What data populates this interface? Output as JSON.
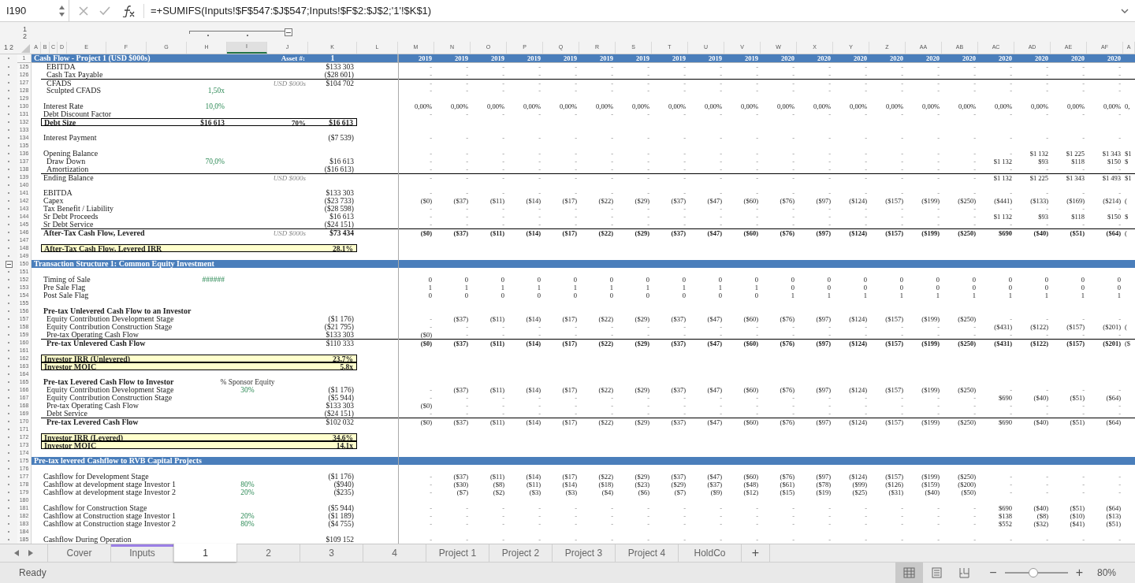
{
  "formula_bar": {
    "cell": "I190",
    "formula": "=+SUMIFS(Inputs!$F$547:$J$547;Inputs!$F$2:$J$2;'1'!$K$1)"
  },
  "outline": {
    "row_levels": [
      "1",
      "2"
    ],
    "col_levels": [
      "1",
      "2"
    ],
    "column_group_expanded": true
  },
  "columns": [
    {
      "letter": "A",
      "selected": false
    },
    {
      "letter": "B",
      "selected": false
    },
    {
      "letter": "C",
      "selected": false
    },
    {
      "letter": "D",
      "selected": false
    },
    {
      "letter": "E",
      "selected": false
    },
    {
      "letter": "F",
      "selected": false
    },
    {
      "letter": "G",
      "selected": false
    },
    {
      "letter": "H",
      "selected": false
    },
    {
      "letter": "I",
      "selected": true
    },
    {
      "letter": "J",
      "selected": false
    },
    {
      "letter": "K",
      "selected": false
    },
    {
      "letter": "L",
      "selected": false
    },
    {
      "letter": "M",
      "selected": false
    },
    {
      "letter": "N",
      "selected": false
    },
    {
      "letter": "O",
      "selected": false
    },
    {
      "letter": "P",
      "selected": false
    },
    {
      "letter": "Q",
      "selected": false
    },
    {
      "letter": "R",
      "selected": false
    },
    {
      "letter": "S",
      "selected": false
    },
    {
      "letter": "T",
      "selected": false
    },
    {
      "letter": "U",
      "selected": false
    },
    {
      "letter": "V",
      "selected": false
    },
    {
      "letter": "W",
      "selected": false
    },
    {
      "letter": "X",
      "selected": false
    },
    {
      "letter": "Y",
      "selected": false
    },
    {
      "letter": "Z",
      "selected": false
    },
    {
      "letter": "AA",
      "selected": false
    },
    {
      "letter": "AB",
      "selected": false
    },
    {
      "letter": "AC",
      "selected": false
    },
    {
      "letter": "AD",
      "selected": false
    },
    {
      "letter": "AE",
      "selected": false
    },
    {
      "letter": "AF",
      "selected": false
    },
    {
      "letter": "A",
      "selected": false
    }
  ],
  "header_row": {
    "num": "1",
    "title": "Cash Flow - Project 1 (USD $000s)",
    "j": "Asset #:",
    "k": "1",
    "years": [
      "2019",
      "2019",
      "2019",
      "2019",
      "2019",
      "2019",
      "2019",
      "2019",
      "2019",
      "2019",
      "2020",
      "2020",
      "2020",
      "2020",
      "2020",
      "2020",
      "2020",
      "2020",
      "2020",
      "2020"
    ]
  },
  "rows": [
    {
      "num": "125",
      "kind": "subitem",
      "label": "EBITDA",
      "k": "$133 303",
      "k_bold": false,
      "t": [
        "-",
        "-",
        "-",
        "-",
        "-",
        "-",
        "-",
        "-",
        "-",
        "-",
        "-",
        "-",
        "-",
        "-",
        "-",
        "-",
        "-",
        "-",
        "-",
        "-"
      ]
    },
    {
      "num": "126",
      "kind": "subitem",
      "label": "Cash Tax Payable",
      "k": "($28 601)",
      "k_bold": false,
      "t": [
        "-",
        "-",
        "-",
        "-",
        "-",
        "-",
        "-",
        "-",
        "-",
        "-",
        "-",
        "-",
        "-",
        "-",
        "-",
        "-",
        "-",
        "-",
        "-",
        "-"
      ]
    },
    {
      "num": "127",
      "kind": "subtotal",
      "label": "CFADS",
      "j": "USD $000s",
      "k": "$104 702",
      "k_bold": false,
      "t": [
        "-",
        "-",
        "-",
        "-",
        "-",
        "-",
        "-",
        "-",
        "-",
        "-",
        "-",
        "-",
        "-",
        "-",
        "-",
        "-",
        "-",
        "-",
        "-",
        "-"
      ]
    },
    {
      "num": "128",
      "kind": "subitem",
      "label": "Sculpted CFADS",
      "h": "1,50x",
      "h_input": true,
      "t": [
        "-",
        "-",
        "-",
        "-",
        "-",
        "-",
        "-",
        "-",
        "-",
        "-",
        "-",
        "-",
        "-",
        "-",
        "-",
        "-",
        "-",
        "-",
        "-",
        "-"
      ]
    },
    {
      "num": "129",
      "kind": "blank"
    },
    {
      "num": "130",
      "kind": "item",
      "label": "Interest Rate",
      "h": "10,0%",
      "h_input": true,
      "t": [
        "0,00%",
        "0,00%",
        "0,00%",
        "0,00%",
        "0,00%",
        "0,00%",
        "0,00%",
        "0,00%",
        "0,00%",
        "0,00%",
        "0,00%",
        "0,00%",
        "0,00%",
        "0,00%",
        "0,00%",
        "0,00%",
        "0,00%",
        "0,00%",
        "0,00%",
        "0,00%"
      ],
      "t_bold": false,
      "tail": "0,"
    },
    {
      "num": "131",
      "kind": "item",
      "label": "Debt Discount Factor",
      "t": [
        "-",
        "-",
        "-",
        "-",
        "-",
        "-",
        "-",
        "-",
        "-",
        "-",
        "-",
        "-",
        "-",
        "-",
        "-",
        "-",
        "-",
        "-",
        "-",
        "-"
      ]
    },
    {
      "num": "132",
      "kind": "box",
      "label": "Debt Size",
      "h": "$16 613",
      "h_input": false,
      "j": "70%",
      "k": "$16 613",
      "k_bold": true
    },
    {
      "num": "133",
      "kind": "blank"
    },
    {
      "num": "134",
      "kind": "item",
      "label": "Interest Payment",
      "k": "($7 539)",
      "k_bold": false,
      "t": [
        "-",
        "-",
        "-",
        "-",
        "-",
        "-",
        "-",
        "-",
        "-",
        "-",
        "-",
        "-",
        "-",
        "-",
        "-",
        "-",
        "-",
        "-",
        "-",
        "-"
      ]
    },
    {
      "num": "135",
      "kind": "blank"
    },
    {
      "num": "136",
      "kind": "item",
      "label": "Opening Balance",
      "t": [
        "-",
        "-",
        "-",
        "-",
        "-",
        "-",
        "-",
        "-",
        "-",
        "-",
        "-",
        "-",
        "-",
        "-",
        "-",
        "-",
        "-",
        "$1 132",
        "$1 225",
        "$1 343"
      ],
      "t_bold": false,
      "tail": "$1"
    },
    {
      "num": "137",
      "kind": "subitem",
      "label": "Draw Down",
      "h": "70,0%",
      "h_input": true,
      "k": "$16 613",
      "k_bold": false,
      "t": [
        "-",
        "-",
        "-",
        "-",
        "-",
        "-",
        "-",
        "-",
        "-",
        "-",
        "-",
        "-",
        "-",
        "-",
        "-",
        "-",
        "$1 132",
        "$93",
        "$118",
        "$150"
      ],
      "t_bold": false,
      "tail": "$"
    },
    {
      "num": "138",
      "kind": "subitem",
      "label": "Amortization",
      "k": "($16 613)",
      "k_bold": false,
      "t": [
        "-",
        "-",
        "-",
        "-",
        "-",
        "-",
        "-",
        "-",
        "-",
        "-",
        "-",
        "-",
        "-",
        "-",
        "-",
        "-",
        "-",
        "-",
        "-",
        "-"
      ]
    },
    {
      "num": "139",
      "kind": "total",
      "label": "Ending Balance",
      "j": "USD $000s",
      "t": [
        "-",
        "-",
        "-",
        "-",
        "-",
        "-",
        "-",
        "-",
        "-",
        "-",
        "-",
        "-",
        "-",
        "-",
        "-",
        "-",
        "$1 132",
        "$1 225",
        "$1 343",
        "$1 493"
      ],
      "t_bold": false,
      "tail": "$1"
    },
    {
      "num": "140",
      "kind": "blank"
    },
    {
      "num": "141",
      "kind": "item",
      "label": "EBITDA",
      "k": "$133 303",
      "k_bold": false,
      "t": [
        "-",
        "-",
        "-",
        "-",
        "-",
        "-",
        "-",
        "-",
        "-",
        "-",
        "-",
        "-",
        "-",
        "-",
        "-",
        "-",
        "-",
        "-",
        "-",
        "-"
      ]
    },
    {
      "num": "142",
      "kind": "item",
      "label": "Capex",
      "k": "($23 733)",
      "k_bold": false,
      "t": [
        "($0)",
        "($37)",
        "($11)",
        "($14)",
        "($17)",
        "($22)",
        "($29)",
        "($37)",
        "($47)",
        "($60)",
        "($76)",
        "($97)",
        "($124)",
        "($157)",
        "($199)",
        "($250)",
        "($441)",
        "($133)",
        "($169)",
        "($214)"
      ],
      "t_bold": false,
      "tail": "("
    },
    {
      "num": "143",
      "kind": "item",
      "label": "Tax Benefit / Liability",
      "k": "($28 598)",
      "k_bold": false,
      "t": [
        "-",
        "-",
        "-",
        "-",
        "-",
        "-",
        "-",
        "-",
        "-",
        "-",
        "-",
        "-",
        "-",
        "-",
        "-",
        "-",
        "-",
        "-",
        "-",
        "-"
      ]
    },
    {
      "num": "144",
      "kind": "item",
      "label": "Sr Debt Proceeds",
      "k": "$16 613",
      "k_bold": false,
      "t": [
        "-",
        "-",
        "-",
        "-",
        "-",
        "-",
        "-",
        "-",
        "-",
        "-",
        "-",
        "-",
        "-",
        "-",
        "-",
        "-",
        "$1 132",
        "$93",
        "$118",
        "$150"
      ],
      "t_bold": false,
      "tail": "$"
    },
    {
      "num": "145",
      "kind": "item",
      "label": "Sr Debt Service",
      "k": "($24 151)",
      "k_bold": false,
      "t": [
        "-",
        "-",
        "-",
        "-",
        "-",
        "-",
        "-",
        "-",
        "-",
        "-",
        "-",
        "-",
        "-",
        "-",
        "-",
        "-",
        "-",
        "-",
        "-",
        "-"
      ]
    },
    {
      "num": "146",
      "kind": "grand_total",
      "label": "After-Tax Cash Flow, Levered",
      "j": "USD $000s",
      "k": "$73 434",
      "k_bold": true,
      "t": [
        "($0)",
        "($37)",
        "($11)",
        "($14)",
        "($17)",
        "($22)",
        "($29)",
        "($37)",
        "($47)",
        "($60)",
        "($76)",
        "($97)",
        "($124)",
        "($157)",
        "($199)",
        "($250)",
        "$690",
        "($40)",
        "($51)",
        "($64)"
      ],
      "t_bold": true,
      "tail": "("
    },
    {
      "num": "147",
      "kind": "blank"
    },
    {
      "num": "148",
      "kind": "highlight",
      "label": "After-Tax Cash Flow, Levered IRR",
      "k": "28,1%",
      "k_bold": true
    },
    {
      "num": "149",
      "kind": "blank"
    },
    {
      "num": "150",
      "kind": "section",
      "label": "Transaction Structure 1: Common Equity Investment",
      "expanded": true
    },
    {
      "num": "151",
      "kind": "blank"
    },
    {
      "num": "152",
      "kind": "item",
      "label": "Timing of Sale",
      "h": "######",
      "h_input": true,
      "t": [
        "0",
        "0",
        "0",
        "0",
        "0",
        "0",
        "0",
        "0",
        "0",
        "0",
        "0",
        "0",
        "0",
        "0",
        "0",
        "0",
        "0",
        "0",
        "0",
        "0"
      ],
      "t_bold": false
    },
    {
      "num": "153",
      "kind": "item",
      "label": "Pre Sale Flag",
      "t": [
        "1",
        "1",
        "1",
        "1",
        "1",
        "1",
        "1",
        "1",
        "1",
        "1",
        "0",
        "0",
        "0",
        "0",
        "0",
        "0",
        "0",
        "0",
        "0",
        "0"
      ],
      "t_bold": false
    },
    {
      "num": "154",
      "kind": "item",
      "label": "Post Sale Flag",
      "t": [
        "0",
        "0",
        "0",
        "0",
        "0",
        "0",
        "0",
        "0",
        "0",
        "0",
        "1",
        "1",
        "1",
        "1",
        "1",
        "1",
        "1",
        "1",
        "1",
        "1"
      ],
      "t_bold": false
    },
    {
      "num": "155",
      "kind": "blank"
    },
    {
      "num": "156",
      "kind": "heading",
      "label": "Pre-tax Unlevered Cash Flow to an Investor"
    },
    {
      "num": "157",
      "kind": "subitem",
      "label": "Equity Contribution Development Stage",
      "k": "($1 176)",
      "k_bold": false,
      "t": [
        "-",
        "($37)",
        "($11)",
        "($14)",
        "($17)",
        "($22)",
        "($29)",
        "($37)",
        "($47)",
        "($60)",
        "($76)",
        "($97)",
        "($124)",
        "($157)",
        "($199)",
        "($250)",
        "-",
        "-",
        "-",
        "-"
      ],
      "t_bold": false
    },
    {
      "num": "158",
      "kind": "subitem",
      "label": "Equity Contribution Construction Stage",
      "k": "($21 795)",
      "k_bold": false,
      "t": [
        "-",
        "-",
        "-",
        "-",
        "-",
        "-",
        "-",
        "-",
        "-",
        "-",
        "-",
        "-",
        "-",
        "-",
        "-",
        "-",
        "($431)",
        "($122)",
        "($157)",
        "($201)"
      ],
      "t_bold": false,
      "tail": "("
    },
    {
      "num": "159",
      "kind": "subitem",
      "label": "Pre-tax Operating Cash Flow",
      "k": "$133 303",
      "k_bold": false,
      "t": [
        "($0)",
        "-",
        "-",
        "-",
        "-",
        "-",
        "-",
        "-",
        "-",
        "-",
        "-",
        "-",
        "-",
        "-",
        "-",
        "-",
        "-",
        "-",
        "-",
        "-"
      ],
      "t_bold": false
    },
    {
      "num": "160",
      "kind": "net_total",
      "label": "Pre-tax Unlevered Cash Flow",
      "k": "$110 333",
      "k_bold": false,
      "t": [
        "($0)",
        "($37)",
        "($11)",
        "($14)",
        "($17)",
        "($22)",
        "($29)",
        "($37)",
        "($47)",
        "($60)",
        "($76)",
        "($97)",
        "($124)",
        "($157)",
        "($199)",
        "($250)",
        "($431)",
        "($122)",
        "($157)",
        "($201)"
      ],
      "t_bold": true,
      "tail": "($"
    },
    {
      "num": "161",
      "kind": "blank"
    },
    {
      "num": "162",
      "kind": "highlight",
      "label": "Investor IRR (Unlevered)",
      "k": "23,7%",
      "k_bold": true
    },
    {
      "num": "163",
      "kind": "highlight",
      "label": "Investor MOIC",
      "k": "5,8x",
      "k_bold": true
    },
    {
      "num": "164",
      "kind": "blank"
    },
    {
      "num": "165",
      "kind": "heading",
      "label": "Pre-tax Levered Cash Flow to Investor",
      "i": "% Sponsor Equity",
      "i_input": false
    },
    {
      "num": "166",
      "kind": "subitem",
      "label": "Equity Contribution Development Stage",
      "i": "30%",
      "i_input": true,
      "k": "($1 176)",
      "k_bold": false,
      "t": [
        "-",
        "($37)",
        "($11)",
        "($14)",
        "($17)",
        "($22)",
        "($29)",
        "($37)",
        "($47)",
        "($60)",
        "($76)",
        "($97)",
        "($124)",
        "($157)",
        "($199)",
        "($250)",
        "-",
        "-",
        "-",
        "-"
      ],
      "t_bold": false
    },
    {
      "num": "167",
      "kind": "subitem",
      "label": "Equity Contribution Construction Stage",
      "k": "($5 944)",
      "k_bold": false,
      "t": [
        "-",
        "-",
        "-",
        "-",
        "-",
        "-",
        "-",
        "-",
        "-",
        "-",
        "-",
        "-",
        "-",
        "-",
        "-",
        "-",
        "$690",
        "($40)",
        "($51)",
        "($64)"
      ],
      "t_bold": false
    },
    {
      "num": "168",
      "kind": "subitem",
      "label": "Pre-tax Operating Cash Flow",
      "k": "$133 303",
      "k_bold": false,
      "t": [
        "($0)",
        "-",
        "-",
        "-",
        "-",
        "-",
        "-",
        "-",
        "-",
        "-",
        "-",
        "-",
        "-",
        "-",
        "-",
        "-",
        "-",
        "-",
        "-",
        "-"
      ],
      "t_bold": false
    },
    {
      "num": "169",
      "kind": "subitem",
      "label": "Debt Service",
      "k": "($24 151)",
      "k_bold": false,
      "t": [
        "-",
        "-",
        "-",
        "-",
        "-",
        "-",
        "-",
        "-",
        "-",
        "-",
        "-",
        "-",
        "-",
        "-",
        "-",
        "-",
        "-",
        "-",
        "-",
        "-"
      ]
    },
    {
      "num": "170",
      "kind": "net_total",
      "label": "Pre-tax Levered Cash Flow",
      "k": "$102 032",
      "k_bold": false,
      "t": [
        "($0)",
        "($37)",
        "($11)",
        "($14)",
        "($17)",
        "($22)",
        "($29)",
        "($37)",
        "($47)",
        "($60)",
        "($76)",
        "($97)",
        "($124)",
        "($157)",
        "($199)",
        "($250)",
        "$690",
        "($40)",
        "($51)",
        "($64)"
      ],
      "t_bold": false
    },
    {
      "num": "171",
      "kind": "blank"
    },
    {
      "num": "172",
      "kind": "highlight",
      "label": "Investor IRR (Levered)",
      "k": "34,6%",
      "k_bold": true
    },
    {
      "num": "173",
      "kind": "highlight",
      "label": "Investor MOIC",
      "k": "14,1x",
      "k_bold": true
    },
    {
      "num": "174",
      "kind": "blank"
    },
    {
      "num": "175",
      "kind": "section",
      "label": "Pre-tax levered Cashflow to RVB Capital Projects"
    },
    {
      "num": "176",
      "kind": "blank"
    },
    {
      "num": "177",
      "kind": "item",
      "label": "Cashflow for Development Stage",
      "k": "($1 176)",
      "k_bold": false,
      "t": [
        "-",
        "($37)",
        "($11)",
        "($14)",
        "($17)",
        "($22)",
        "($29)",
        "($37)",
        "($47)",
        "($60)",
        "($76)",
        "($97)",
        "($124)",
        "($157)",
        "($199)",
        "($250)",
        "-",
        "-",
        "-",
        "-"
      ],
      "t_bold": false
    },
    {
      "num": "178",
      "kind": "item",
      "label": "Cashflow at development stage Investor 1",
      "i": "80%",
      "i_input": true,
      "k": "($940)",
      "k_bold": false,
      "t": [
        "-",
        "($30)",
        "($8)",
        "($11)",
        "($14)",
        "($18)",
        "($23)",
        "($29)",
        "($37)",
        "($48)",
        "($61)",
        "($78)",
        "($99)",
        "($126)",
        "($159)",
        "($200)",
        "-",
        "-",
        "-",
        "-"
      ],
      "t_bold": false
    },
    {
      "num": "179",
      "kind": "item",
      "label": "Cashflow at development stage Investor 2",
      "i": "20%",
      "i_input": true,
      "k": "($235)",
      "k_bold": false,
      "t": [
        "-",
        "($7)",
        "($2)",
        "($3)",
        "($3)",
        "($4)",
        "($6)",
        "($7)",
        "($9)",
        "($12)",
        "($15)",
        "($19)",
        "($25)",
        "($31)",
        "($40)",
        "($50)",
        "-",
        "-",
        "-",
        "-"
      ],
      "t_bold": false
    },
    {
      "num": "180",
      "kind": "blank"
    },
    {
      "num": "181",
      "kind": "item",
      "label": "Cashflow for Construction Stage",
      "k": "($5 944)",
      "k_bold": false,
      "t": [
        "-",
        "-",
        "-",
        "-",
        "-",
        "-",
        "-",
        "-",
        "-",
        "-",
        "-",
        "-",
        "-",
        "-",
        "-",
        "-",
        "$690",
        "($40)",
        "($51)",
        "($64)"
      ],
      "t_bold": false
    },
    {
      "num": "182",
      "kind": "item",
      "label": "Cashflow at Construction stage Investor 1",
      "i": "20%",
      "i_input": true,
      "k": "($1 189)",
      "k_bold": false,
      "t": [
        "-",
        "-",
        "-",
        "-",
        "-",
        "-",
        "-",
        "-",
        "-",
        "-",
        "-",
        "-",
        "-",
        "-",
        "-",
        "-",
        "$138",
        "($8)",
        "($10)",
        "($13)"
      ],
      "t_bold": false
    },
    {
      "num": "183",
      "kind": "item",
      "label": "Cashflow at Construction stage Investor 2",
      "i": "80%",
      "i_input": true,
      "k": "($4 755)",
      "k_bold": false,
      "t": [
        "-",
        "-",
        "-",
        "-",
        "-",
        "-",
        "-",
        "-",
        "-",
        "-",
        "-",
        "-",
        "-",
        "-",
        "-",
        "-",
        "$552",
        "($32)",
        "($41)",
        "($51)"
      ],
      "t_bold": false
    },
    {
      "num": "184",
      "kind": "blank"
    },
    {
      "num": "185",
      "kind": "item",
      "label": "Cashflow During Operation",
      "k": "$109 152",
      "k_bold": false,
      "t": [
        "-",
        "-",
        "-",
        "-",
        "-",
        "-",
        "-",
        "-",
        "-",
        "-",
        "-",
        "-",
        "-",
        "-",
        "-",
        "-",
        "-",
        "-",
        "-",
        "-"
      ]
    }
  ],
  "sheet_tabs": [
    {
      "label": "Cover",
      "selected": false
    },
    {
      "label": "Inputs",
      "selected": false,
      "color": "#9b7fe6"
    },
    {
      "label": "1",
      "selected": true
    },
    {
      "label": "2",
      "selected": false
    },
    {
      "label": "3",
      "selected": false
    },
    {
      "label": "4",
      "selected": false
    },
    {
      "label": "Project 1",
      "selected": false
    },
    {
      "label": "Project 2",
      "selected": false
    },
    {
      "label": "Project 3",
      "selected": false
    },
    {
      "label": "Project 4",
      "selected": false
    },
    {
      "label": "HoldCo",
      "selected": false
    }
  ],
  "add_sheet": "+",
  "status_bar": {
    "text": "Ready",
    "views": [
      {
        "kind": "normal",
        "selected": true
      },
      {
        "kind": "page_layout",
        "selected": false
      },
      {
        "kind": "page_break",
        "selected": false
      }
    ],
    "zoom": {
      "minus": "−",
      "plus": "+",
      "level": 0.45,
      "text": "80%"
    }
  }
}
